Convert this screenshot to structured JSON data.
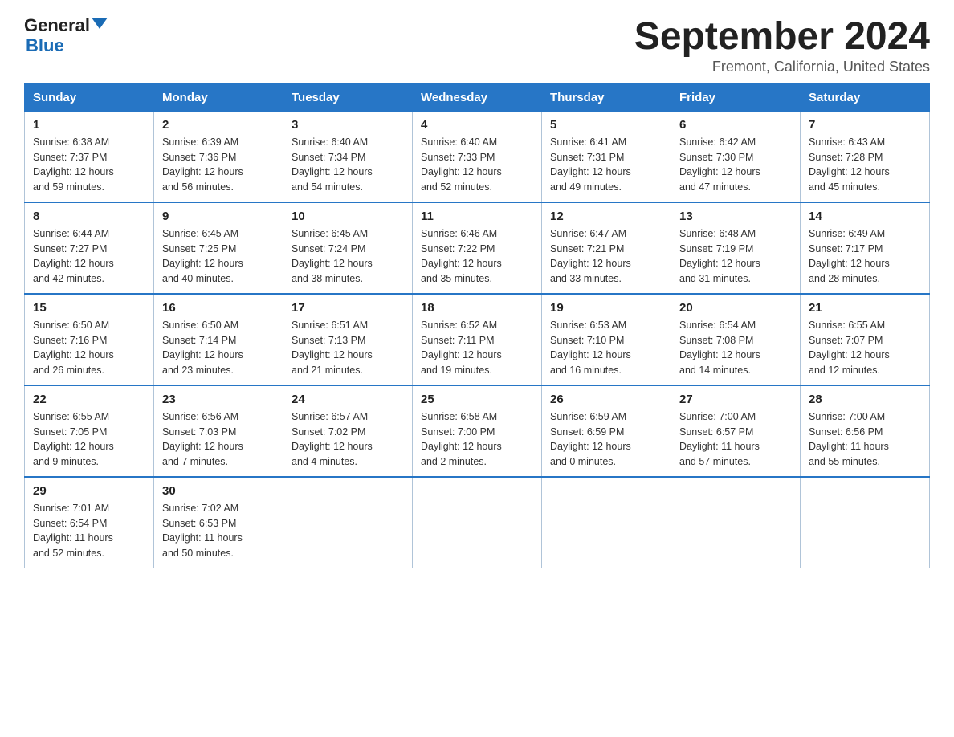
{
  "header": {
    "logo_general": "General",
    "logo_blue": "Blue",
    "month_title": "September 2024",
    "location": "Fremont, California, United States"
  },
  "weekdays": [
    "Sunday",
    "Monday",
    "Tuesday",
    "Wednesday",
    "Thursday",
    "Friday",
    "Saturday"
  ],
  "weeks": [
    [
      {
        "day": "1",
        "sunrise": "6:38 AM",
        "sunset": "7:37 PM",
        "daylight": "12 hours and 59 minutes."
      },
      {
        "day": "2",
        "sunrise": "6:39 AM",
        "sunset": "7:36 PM",
        "daylight": "12 hours and 56 minutes."
      },
      {
        "day": "3",
        "sunrise": "6:40 AM",
        "sunset": "7:34 PM",
        "daylight": "12 hours and 54 minutes."
      },
      {
        "day": "4",
        "sunrise": "6:40 AM",
        "sunset": "7:33 PM",
        "daylight": "12 hours and 52 minutes."
      },
      {
        "day": "5",
        "sunrise": "6:41 AM",
        "sunset": "7:31 PM",
        "daylight": "12 hours and 49 minutes."
      },
      {
        "day": "6",
        "sunrise": "6:42 AM",
        "sunset": "7:30 PM",
        "daylight": "12 hours and 47 minutes."
      },
      {
        "day": "7",
        "sunrise": "6:43 AM",
        "sunset": "7:28 PM",
        "daylight": "12 hours and 45 minutes."
      }
    ],
    [
      {
        "day": "8",
        "sunrise": "6:44 AM",
        "sunset": "7:27 PM",
        "daylight": "12 hours and 42 minutes."
      },
      {
        "day": "9",
        "sunrise": "6:45 AM",
        "sunset": "7:25 PM",
        "daylight": "12 hours and 40 minutes."
      },
      {
        "day": "10",
        "sunrise": "6:45 AM",
        "sunset": "7:24 PM",
        "daylight": "12 hours and 38 minutes."
      },
      {
        "day": "11",
        "sunrise": "6:46 AM",
        "sunset": "7:22 PM",
        "daylight": "12 hours and 35 minutes."
      },
      {
        "day": "12",
        "sunrise": "6:47 AM",
        "sunset": "7:21 PM",
        "daylight": "12 hours and 33 minutes."
      },
      {
        "day": "13",
        "sunrise": "6:48 AM",
        "sunset": "7:19 PM",
        "daylight": "12 hours and 31 minutes."
      },
      {
        "day": "14",
        "sunrise": "6:49 AM",
        "sunset": "7:17 PM",
        "daylight": "12 hours and 28 minutes."
      }
    ],
    [
      {
        "day": "15",
        "sunrise": "6:50 AM",
        "sunset": "7:16 PM",
        "daylight": "12 hours and 26 minutes."
      },
      {
        "day": "16",
        "sunrise": "6:50 AM",
        "sunset": "7:14 PM",
        "daylight": "12 hours and 23 minutes."
      },
      {
        "day": "17",
        "sunrise": "6:51 AM",
        "sunset": "7:13 PM",
        "daylight": "12 hours and 21 minutes."
      },
      {
        "day": "18",
        "sunrise": "6:52 AM",
        "sunset": "7:11 PM",
        "daylight": "12 hours and 19 minutes."
      },
      {
        "day": "19",
        "sunrise": "6:53 AM",
        "sunset": "7:10 PM",
        "daylight": "12 hours and 16 minutes."
      },
      {
        "day": "20",
        "sunrise": "6:54 AM",
        "sunset": "7:08 PM",
        "daylight": "12 hours and 14 minutes."
      },
      {
        "day": "21",
        "sunrise": "6:55 AM",
        "sunset": "7:07 PM",
        "daylight": "12 hours and 12 minutes."
      }
    ],
    [
      {
        "day": "22",
        "sunrise": "6:55 AM",
        "sunset": "7:05 PM",
        "daylight": "12 hours and 9 minutes."
      },
      {
        "day": "23",
        "sunrise": "6:56 AM",
        "sunset": "7:03 PM",
        "daylight": "12 hours and 7 minutes."
      },
      {
        "day": "24",
        "sunrise": "6:57 AM",
        "sunset": "7:02 PM",
        "daylight": "12 hours and 4 minutes."
      },
      {
        "day": "25",
        "sunrise": "6:58 AM",
        "sunset": "7:00 PM",
        "daylight": "12 hours and 2 minutes."
      },
      {
        "day": "26",
        "sunrise": "6:59 AM",
        "sunset": "6:59 PM",
        "daylight": "12 hours and 0 minutes."
      },
      {
        "day": "27",
        "sunrise": "7:00 AM",
        "sunset": "6:57 PM",
        "daylight": "11 hours and 57 minutes."
      },
      {
        "day": "28",
        "sunrise": "7:00 AM",
        "sunset": "6:56 PM",
        "daylight": "11 hours and 55 minutes."
      }
    ],
    [
      {
        "day": "29",
        "sunrise": "7:01 AM",
        "sunset": "6:54 PM",
        "daylight": "11 hours and 52 minutes."
      },
      {
        "day": "30",
        "sunrise": "7:02 AM",
        "sunset": "6:53 PM",
        "daylight": "11 hours and 50 minutes."
      },
      null,
      null,
      null,
      null,
      null
    ]
  ]
}
